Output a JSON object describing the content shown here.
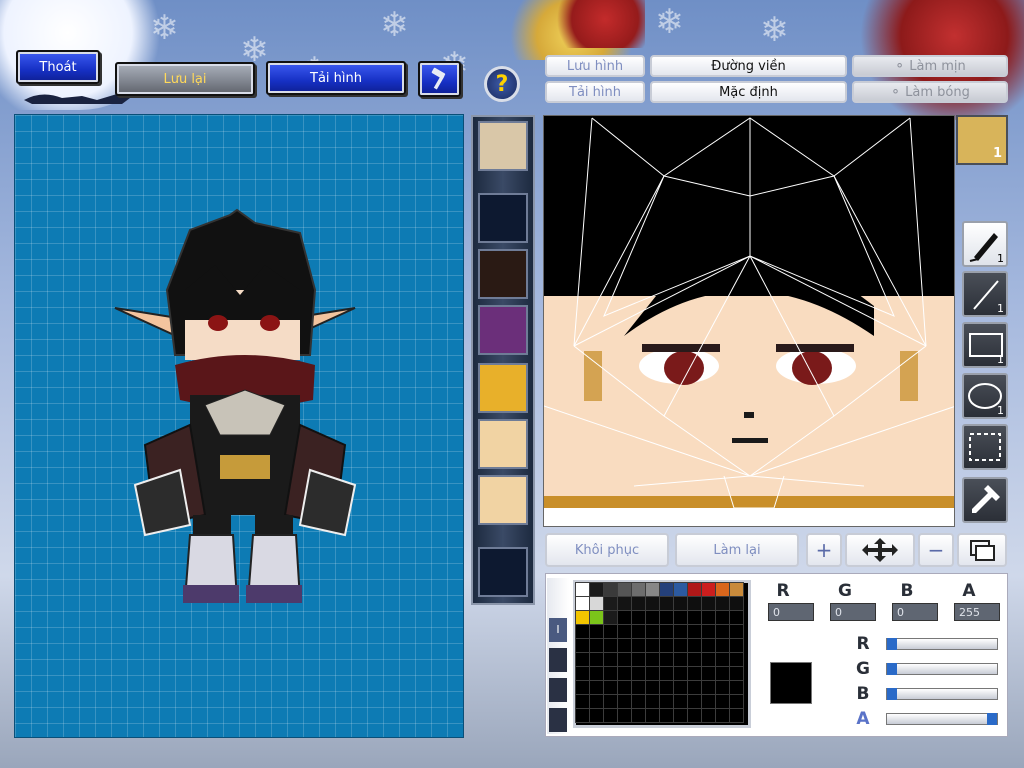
{
  "toolbar": {
    "exit_label": "Thoát",
    "save_label": "Lưu lại",
    "reload_label": "Tải hình",
    "hammer_icon": "hammer-icon"
  },
  "editor_buttons": {
    "save_image": "Lưu hình",
    "reload_image": "Tải hình",
    "outline": "Đường viền",
    "default": "Mặc định",
    "smooth": "Làm mịn",
    "shade": "Làm bóng",
    "restore": "Khôi phục",
    "redo": "Làm lại"
  },
  "badges": {
    "face_count": "1",
    "tool_counts": [
      "1",
      "1",
      "1",
      "1"
    ]
  },
  "color_values": {
    "r_label": "R",
    "g_label": "G",
    "b_label": "B",
    "a_label": "A",
    "r": "0",
    "g": "0",
    "b": "0",
    "a": "255"
  },
  "palette": {
    "row1": [
      "#ffffff",
      "#1a1a1a",
      "#3a3a3a",
      "#555555",
      "#6d6d6d",
      "#878787",
      "#24407a",
      "#2c5aa0",
      "#b01818",
      "#cc1e1e",
      "#d9661c",
      "#c88a3b",
      "#9a7a40"
    ],
    "row2": [
      "#ffffff",
      "#d8d8d8",
      "#1b1b1b",
      "#141414",
      "#111111",
      "#111111",
      "#101010",
      "#0f0f0f",
      "#0f0f0f",
      "#0f0f0f",
      "#0f0f0f",
      "#0f0f0f",
      "#0f0f0f"
    ],
    "row3": [
      "#f2c500",
      "#7bc41a",
      "#1b1b1b"
    ],
    "selected_color": "#000000"
  },
  "sliders": {
    "r": 0.0,
    "g": 0.0,
    "b": 0.0,
    "a": 1.0
  }
}
